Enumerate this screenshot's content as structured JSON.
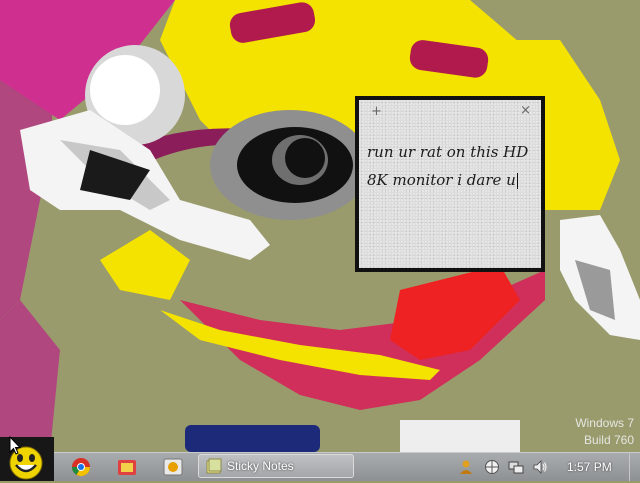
{
  "sticky_note": {
    "add_glyph": "+",
    "close_glyph": "×",
    "text": "run ur rat on this HD\n8K monitor i dare u"
  },
  "watermark": {
    "line1": "Windows 7",
    "line2": "Build 760"
  },
  "taskbar": {
    "pinned": [
      {
        "name": "chrome-icon"
      },
      {
        "name": "paint-icon"
      },
      {
        "name": "photo-viewer-icon"
      }
    ],
    "active_window": {
      "icon": "sticky-notes-icon",
      "label": "Sticky Notes"
    },
    "tray_icons": [
      "user-icon",
      "globe-icon",
      "network-icon",
      "volume-icon"
    ],
    "clock": "1:57 PM"
  }
}
